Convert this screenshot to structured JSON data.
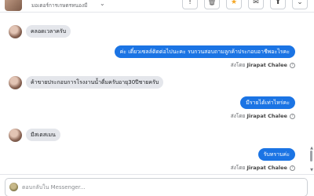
{
  "header": {
    "name": "มอเตอร์การเกษตรหนองมี",
    "tools": [
      {
        "icon": "info-icon",
        "glyph": "!"
      },
      {
        "icon": "trash-icon",
        "glyph": "🗑"
      },
      {
        "icon": "star-icon",
        "glyph": "★"
      },
      {
        "icon": "mail-icon",
        "glyph": "✉"
      },
      {
        "icon": "share-icon",
        "glyph": "⬆"
      },
      {
        "icon": "chevron-down-icon",
        "glyph": "⌄"
      }
    ]
  },
  "messages": [
    {
      "type": "in",
      "text": "คลอดเวลาครับ"
    },
    {
      "type": "out",
      "text": "ค่ะ เดี๋ยวเซลล์ติดต่อไปนะคะ รบกวนสอบถามลูกค้าประกอบอาชีพอะไรคะ",
      "sent_label": "ส่งโดย",
      "sender": "Jirapat Chalee"
    },
    {
      "type": "in",
      "text": "ค้าขายประกอบการโรงงานน้ำดื่มครับอายุ30ปีชายครับ"
    },
    {
      "type": "out",
      "text": "มีรายได้เท่าไหร่คะ",
      "sent_label": "ส่งโดย",
      "sender": "Jirapat Chalee"
    },
    {
      "type": "in",
      "text": "มีสเตสเมน"
    },
    {
      "type": "out",
      "text": "รับทราบค่ะ",
      "sent_label": "ส่งโดย",
      "sender": "Jirapat Chalee"
    }
  ],
  "composer": {
    "placeholder": "ตอบกลับใน Messenger..."
  },
  "colors": {
    "outgoing_bubble": "#1b74e4",
    "incoming_bubble": "#e4e6eb",
    "star": "#f5a623"
  }
}
